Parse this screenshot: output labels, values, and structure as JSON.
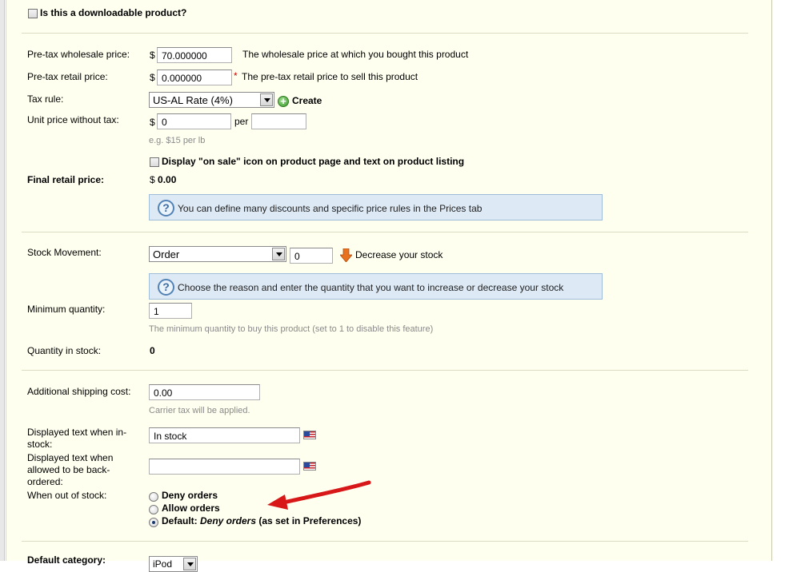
{
  "downloadable": {
    "label": "Is this a downloadable product?"
  },
  "pricing": {
    "wholesale": {
      "label": "Pre-tax wholesale price:",
      "currency": "$",
      "value": "70.000000",
      "help": "The wholesale price at which you bought this product"
    },
    "retail": {
      "label": "Pre-tax retail price:",
      "currency": "$",
      "value": "0.000000",
      "required_mark": "*",
      "help": "The pre-tax retail price to sell this product"
    },
    "tax_rule": {
      "label": "Tax rule:",
      "selected": "US-AL Rate (4%)",
      "create_label": "Create"
    },
    "unit_price": {
      "label": "Unit price without tax:",
      "currency": "$",
      "value": "0",
      "per_label": "per",
      "per_value": "",
      "hint": "e.g. $15 per lb"
    },
    "on_sale": {
      "label": "Display \"on sale\" icon on product page and text on product listing"
    },
    "final": {
      "label": "Final retail price:",
      "currency": "$",
      "value": "0.00"
    },
    "info": "You can define many discounts and specific price rules in the Prices tab"
  },
  "stock": {
    "movement": {
      "label": "Stock Movement:",
      "selected": "Order",
      "quantity": "0",
      "action_label": "Decrease your stock"
    },
    "info": "Choose the reason and enter the quantity that you want to increase or decrease your stock",
    "minimum": {
      "label": "Minimum quantity:",
      "value": "1",
      "hint": "The minimum quantity to buy this product (set to 1 to disable this feature)"
    },
    "in_stock": {
      "label": "Quantity in stock:",
      "value": "0"
    }
  },
  "shipping": {
    "additional": {
      "label": "Additional shipping cost:",
      "value": "0.00",
      "hint": "Carrier tax will be applied."
    },
    "in_stock_text": {
      "label_line1": "Displayed text when in-",
      "label_line2": "stock:",
      "value": "In stock"
    },
    "backorder_text": {
      "label_line1": "Displayed text when",
      "label_line2": "allowed to be back-",
      "label_line3": "ordered:",
      "value": ""
    },
    "out_of_stock": {
      "label": "When out of stock:",
      "options": [
        "Deny orders",
        "Allow orders"
      ],
      "default_prefix": "Default: ",
      "default_value": "Deny orders",
      "default_suffix": " (as set in Preferences)",
      "selected_index": 2
    }
  },
  "category": {
    "label": "Default category:",
    "selected": "iPod"
  },
  "colors": {
    "panel_bg": "#fffff0",
    "info_bg": "#dde9f5",
    "arrow": "#e02020"
  }
}
